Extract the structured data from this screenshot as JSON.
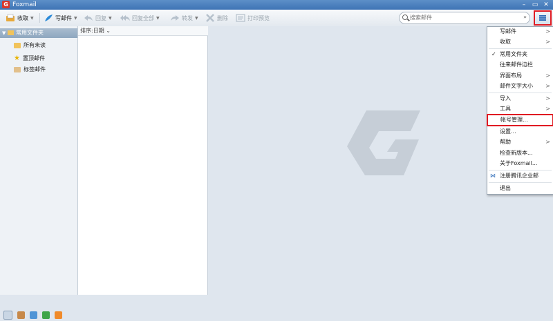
{
  "window": {
    "title": "Foxmail",
    "logo": "G"
  },
  "toolbar": {
    "receive": "收取",
    "compose": "写邮件",
    "reply": "回复",
    "reply_all": "回复全部",
    "forward": "转发",
    "delete": "删除",
    "print_preview": "打印预览"
  },
  "search": {
    "placeholder": "搜索邮件"
  },
  "sidebar": {
    "group": "常用文件夹",
    "items": [
      {
        "label": "所有未读"
      },
      {
        "label": "置顶邮件"
      },
      {
        "label": "标签邮件"
      }
    ]
  },
  "maillist": {
    "sort": "排序:日期"
  },
  "menu": {
    "items": [
      {
        "label": "写邮件",
        "arrow": ">"
      },
      {
        "label": "收取",
        "arrow": ">"
      },
      {
        "label": "常用文件夹",
        "check": "✓"
      },
      {
        "label": "往来邮件边栏"
      },
      {
        "label": "界面布局",
        "arrow": ">"
      },
      {
        "label": "邮件文字大小",
        "arrow": ">"
      },
      {
        "label": "导入",
        "arrow": ">"
      },
      {
        "label": "工具",
        "arrow": ">"
      },
      {
        "label": "帐号管理..."
      },
      {
        "label": "设置..."
      },
      {
        "label": "帮助",
        "arrow": ">"
      },
      {
        "label": "检查新版本..."
      },
      {
        "label": "关于Foxmail..."
      },
      {
        "label": "注册腾讯企业邮",
        "prefix": "⋈"
      },
      {
        "label": "退出"
      }
    ]
  },
  "colors": {
    "accent": "#2c6bb7",
    "highlight": "#e01a22",
    "brand": "#d9362b"
  }
}
